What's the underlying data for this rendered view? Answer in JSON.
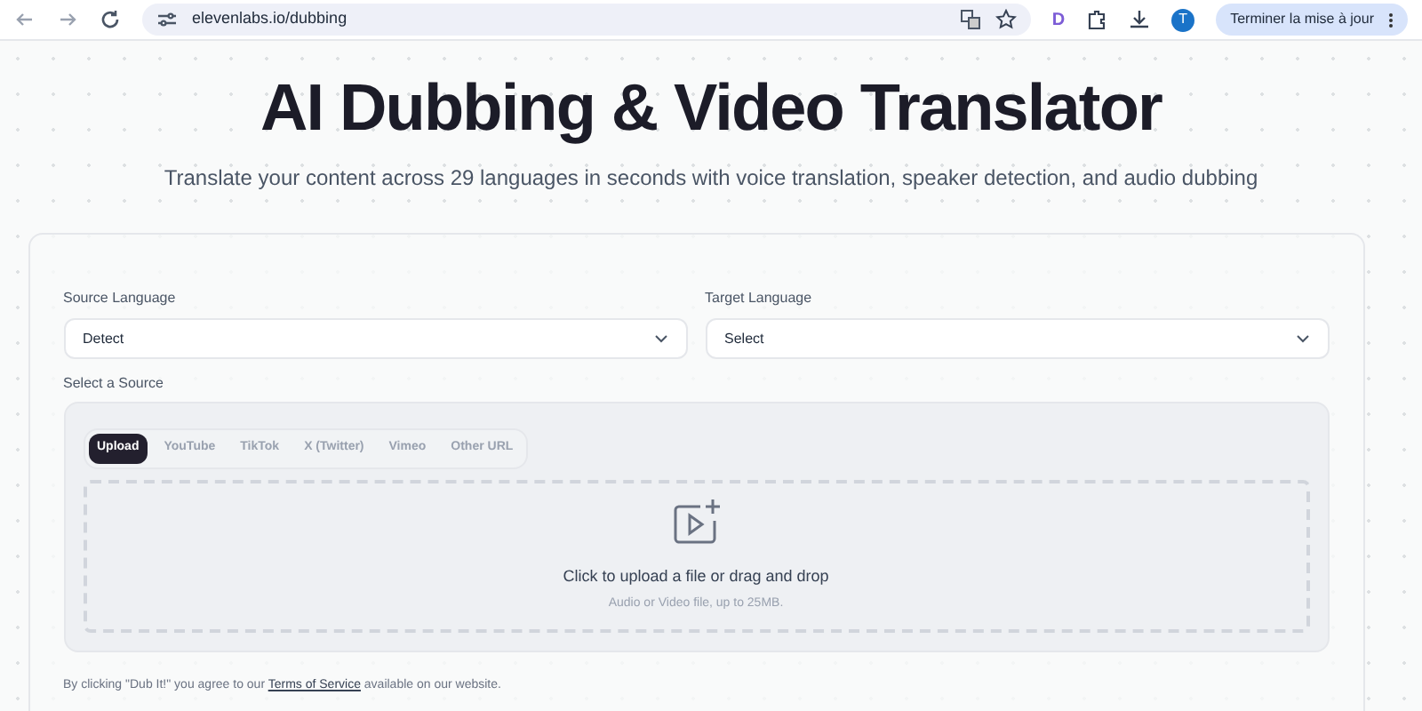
{
  "browser": {
    "url": "elevenlabs.io/dubbing",
    "extension_letter": "D",
    "profile_initial": "T",
    "update_button": "Terminer la mise à jour"
  },
  "hero": {
    "title": "AI Dubbing & Video Translator",
    "subtitle": "Translate your content across 29 languages in seconds with voice translation, speaker detection, and audio dubbing"
  },
  "form": {
    "fields": [
      {
        "label": "Source Language",
        "value": "Detect"
      },
      {
        "label": "Target Language",
        "value": "Select"
      }
    ],
    "source_label": "Select a Source",
    "tabs": [
      {
        "label": "Upload",
        "selected": true
      },
      {
        "label": "YouTube",
        "selected": false
      },
      {
        "label": "TikTok",
        "selected": false
      },
      {
        "label": "X (Twitter)",
        "selected": false
      },
      {
        "label": "Vimeo",
        "selected": false
      },
      {
        "label": "Other URL",
        "selected": false
      }
    ],
    "dropzone": {
      "title": "Click to upload a file or drag and drop",
      "hint": "Audio or Video file, up to 25MB."
    },
    "terms": {
      "before": "By clicking \"Dub It!\" you agree to our",
      "link": "Terms of Service",
      "after": "available on our website."
    }
  }
}
